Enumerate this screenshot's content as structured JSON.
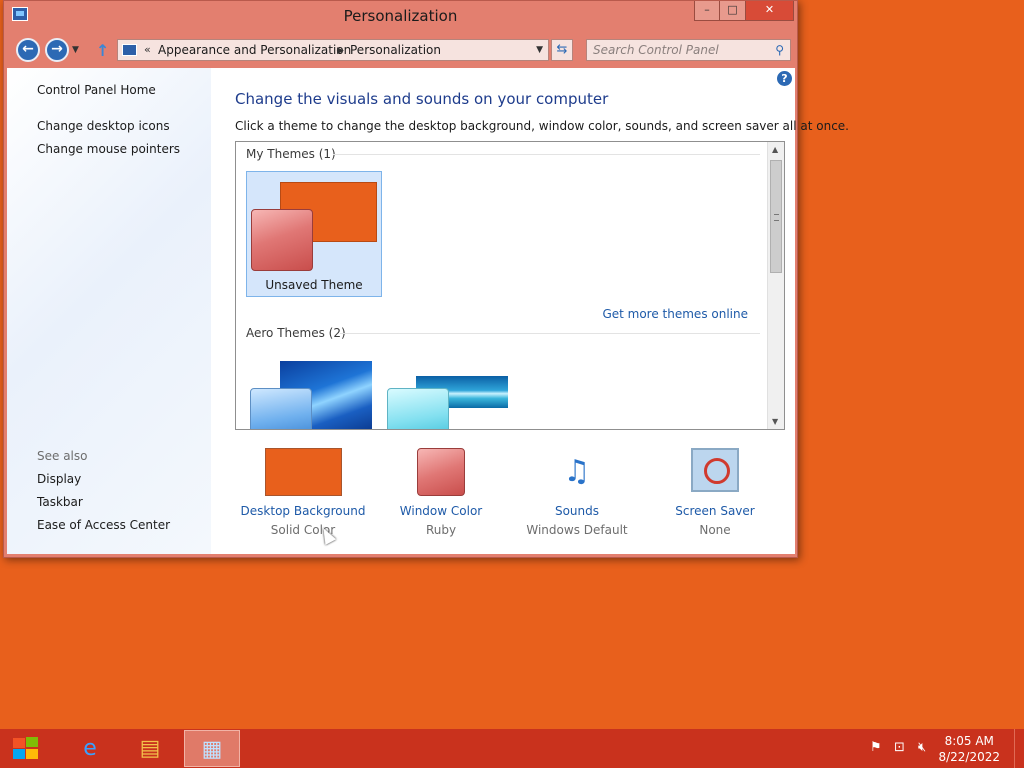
{
  "window": {
    "title": "Personalization",
    "controls": {
      "minimize": "–",
      "maximize": "□",
      "close": "✕"
    }
  },
  "nav": {
    "back_icon": "back-arrow-icon",
    "forward_icon": "forward-arrow-icon",
    "address": {
      "chevron": "«",
      "crumbs": [
        "Appearance and Personalization",
        "Personalization"
      ]
    },
    "search": {
      "placeholder": "Search Control Panel"
    }
  },
  "sidebar": {
    "links": [
      "Control Panel Home",
      "Change desktop icons",
      "Change mouse pointers"
    ],
    "see_also_label": "See also",
    "see_also": [
      "Display",
      "Taskbar",
      "Ease of Access Center"
    ]
  },
  "main": {
    "heading": "Change the visuals and sounds on your computer",
    "description": "Click a theme to change the desktop background, window color, sounds, and screen saver all at once.",
    "help_label": "?",
    "groups": {
      "my_themes": "My Themes (1)",
      "aero_themes": "Aero Themes (2)"
    },
    "selected_theme": "Unsaved Theme",
    "get_more": "Get more themes online",
    "bottom": [
      {
        "label": "Desktop Background",
        "value": "Solid Color",
        "icon": "desktop-background-icon"
      },
      {
        "label": "Window Color",
        "value": "Ruby",
        "icon": "window-color-icon"
      },
      {
        "label": "Sounds",
        "value": "Windows Default",
        "icon": "sounds-icon"
      },
      {
        "label": "Screen Saver",
        "value": "None",
        "icon": "screen-saver-icon"
      }
    ]
  },
  "taskbar": {
    "apps": [
      "internet-explorer-icon",
      "file-explorer-icon",
      "control-panel-icon"
    ],
    "tray_icons": [
      "action-center-flag-icon",
      "network-icon",
      "volume-muted-icon"
    ],
    "time": "8:05 AM",
    "date": "8/22/2022"
  },
  "colors": {
    "desktop": "#e8601c",
    "window_frame": "#e37f6f",
    "taskbar": "#c9321d",
    "link": "#1e5aa8"
  }
}
